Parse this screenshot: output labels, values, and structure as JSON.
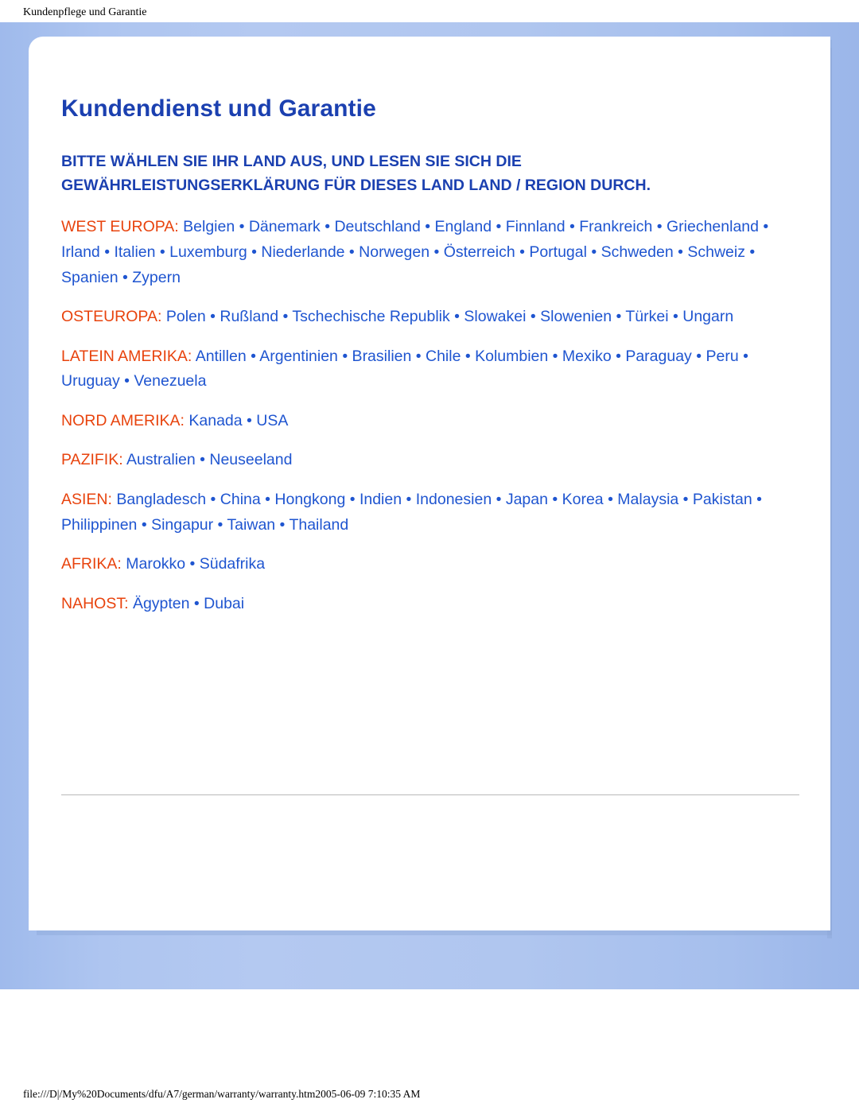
{
  "browser": {
    "page_header": "Kundenpflege und Garantie",
    "page_footer": "file:///D|/My%20Documents/dfu/A7/german/warranty/warranty.htm2005-06-09 7:10:35 AM"
  },
  "document": {
    "title": "Kundendienst und Garantie",
    "intro": "BITTE WÄHLEN SIE IHR LAND AUS, UND LESEN SIE SICH DIE GEWÄHRLEISTUNGSERKLÄRUNG FÜR DIESES LAND LAND / REGION DURCH.",
    "regions": [
      {
        "label": "WEST EUROPA:",
        "countries": "Belgien • Dänemark • Deutschland • England • Finnland • Frankreich • Griechenland • Irland • Italien • Luxemburg • Niederlande • Norwegen • Österreich • Portugal • Schweden • Schweiz • Spanien • Zypern"
      },
      {
        "label": "OSTEUROPA:",
        "countries": "Polen • Rußland • Tschechische Republik • Slowakei • Slowenien • Türkei • Ungarn"
      },
      {
        "label": "LATEIN AMERIKA:",
        "countries": "Antillen • Argentinien • Brasilien • Chile • Kolumbien • Mexiko • Paraguay • Peru • Uruguay • Venezuela"
      },
      {
        "label": "NORD AMERIKA:",
        "countries": "Kanada • USA"
      },
      {
        "label": "PAZIFIK:",
        "countries": "Australien • Neuseeland"
      },
      {
        "label": "ASIEN:",
        "countries": "Bangladesch • China • Hongkong • Indien • Indonesien • Japan • Korea • Malaysia • Pakistan • Philippinen • Singapur • Taiwan • Thailand"
      },
      {
        "label": "AFRIKA:",
        "countries": "Marokko • Südafrika"
      },
      {
        "label": "NAHOST:",
        "countries": "Ägypten • Dubai"
      }
    ]
  },
  "colors": {
    "title": "#1b40b0",
    "link": "#1f55d0",
    "region_label": "#e8430d",
    "page_background": "#aec5f0"
  }
}
